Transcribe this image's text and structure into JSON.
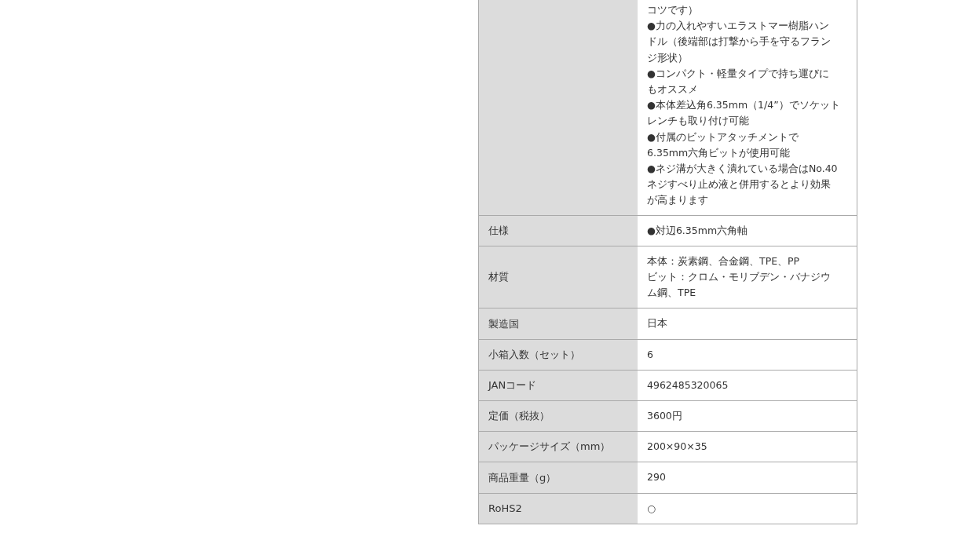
{
  "spec_table": {
    "rows": [
      {
        "label": "",
        "lines": [
          "コツです）",
          "●力の入れやすいエラストマー樹脂ハン",
          "ドル（後端部は打撃から手を守るフラン",
          "ジ形状）",
          "●コンパクト・軽量タイプで持ち運びに",
          "もオススメ",
          "●本体差込角6.35mm（1/4”）でソケット",
          "レンチも取り付け可能",
          "●付属のビットアタッチメントで",
          "6.35mm六角ビットが使用可能",
          "●ネジ溝が大きく潰れている場合はNo.40",
          "ネジすべり止め液と併用するとより効果",
          "が高まります"
        ]
      },
      {
        "label": "仕様",
        "lines": [
          "●対辺6.35mm六角軸"
        ]
      },
      {
        "label": "材質",
        "lines": [
          "本体：炭素鋼、合金鋼、TPE、PP",
          "ビット：クロム・モリブデン・バナジウ",
          "ム鋼、TPE"
        ]
      },
      {
        "label": "製造国",
        "lines": [
          "日本"
        ]
      },
      {
        "label": "小箱入数（セット）",
        "lines": [
          "6"
        ]
      },
      {
        "label": "JANコード",
        "lines": [
          "4962485320065"
        ]
      },
      {
        "label": "定価（税抜）",
        "lines": [
          "3600円"
        ]
      },
      {
        "label": "パッケージサイズ（mm）",
        "lines": [
          "200×90×35"
        ]
      },
      {
        "label": "商品重量（g）",
        "lines": [
          "290"
        ]
      },
      {
        "label": "RoHS2",
        "lines": [
          "○"
        ]
      }
    ]
  }
}
